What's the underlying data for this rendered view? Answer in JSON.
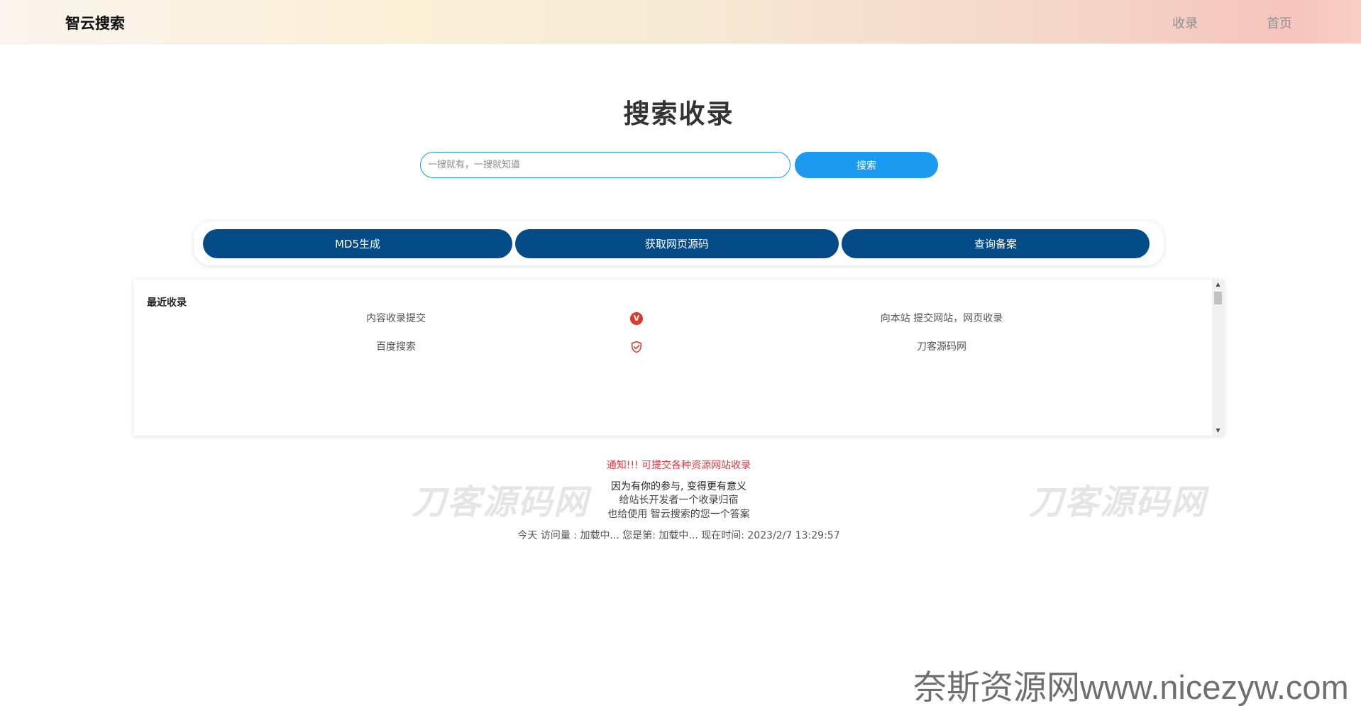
{
  "header": {
    "brand": "智云搜索",
    "nav": [
      {
        "label": "收录"
      },
      {
        "label": "首页"
      }
    ],
    "gradient": [
      "#fbf5ef",
      "#fbefd6",
      "#f4d6c9",
      "#f6c5bd"
    ]
  },
  "main": {
    "title": "搜索收录",
    "search": {
      "placeholder": "一搜就有，一搜就知道",
      "value": "",
      "button_label": "搜索"
    },
    "tools": [
      {
        "label": "MD5生成"
      },
      {
        "label": "获取网页源码"
      },
      {
        "label": "查询备案"
      }
    ]
  },
  "recent": {
    "title": "最近收录",
    "rows": [
      {
        "name": "内容收录提交",
        "icon": "v-badge-icon",
        "desc": "向本站 提交网站，网页收录"
      },
      {
        "name": "百度搜索",
        "icon": "shield-check-icon",
        "desc": "刀客源码网"
      }
    ],
    "badge_text": "V"
  },
  "footer": {
    "notice": "通知!!! 可提交各种资源网站收录",
    "line1": "因为有你的参与, 变得更有意义",
    "line2": "给站长开发者一个收录归宿",
    "line3": "也给使用 智云搜索的您一个答案",
    "stats": "今天 访问量 : 加载中... 您是第: 加载中... 现在时间: 2023/2/7 13:29:57"
  },
  "watermarks": {
    "left": "刀客源码网",
    "right": "刀客源码网",
    "bottom": "奈斯资源网www.nicezyw.com"
  },
  "colors": {
    "accent": "#1b9af0",
    "tool_button": "#034b87",
    "notice": "#e0393e",
    "badge": "#d93a2b"
  }
}
